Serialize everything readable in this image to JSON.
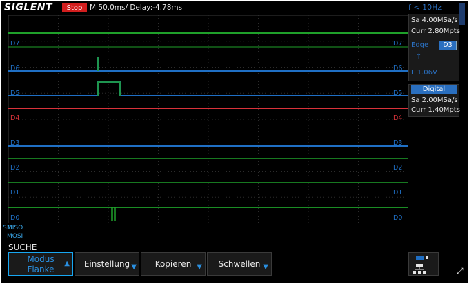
{
  "topbar": {
    "brand": "SIGLENT",
    "run_state": "Stop",
    "timebase": "M 50.0ms/ Delay:-4.78ms",
    "trigger_freq": "f < 10Hz"
  },
  "acq_panel": {
    "sample_rate": "Sa 4.00MSa/s",
    "memory_depth": "Curr 2.80Mpts"
  },
  "trigger_panel": {
    "type": "Edge",
    "source": "D3",
    "level": "L  1.06V"
  },
  "digital_panel": {
    "header": "Digital",
    "sample_rate": "Sa 2.00MSa/s",
    "memory_depth": "Curr 1.40Mpts"
  },
  "channels": [
    {
      "label": "D7",
      "color": "#1fa02a"
    },
    {
      "label": "D6",
      "color": "#1f6fc4"
    },
    {
      "label": "D5",
      "color": "#1f6fc4"
    },
    {
      "label": "D4",
      "color": "#d8323a"
    },
    {
      "label": "D3",
      "color": "#1f6fc4"
    },
    {
      "label": "D2",
      "color": "#1fa02a"
    },
    {
      "label": "D1",
      "color": "#1fa02a"
    },
    {
      "label": "D0",
      "color": "#1fa02a"
    }
  ],
  "bus": {
    "marker": "S1",
    "line1": "MISO",
    "line2": "MOSI"
  },
  "menu": {
    "title": "SUCHE",
    "buttons": [
      {
        "line1": "Modus",
        "line2": "Flanke"
      },
      {
        "label": "Einstellung"
      },
      {
        "label": "Kopieren"
      },
      {
        "label": "Schwellen"
      }
    ]
  },
  "colors": {
    "accent": "#18a7f2",
    "stop_red": "#d21e1e",
    "grid": "#3a3a3a"
  }
}
